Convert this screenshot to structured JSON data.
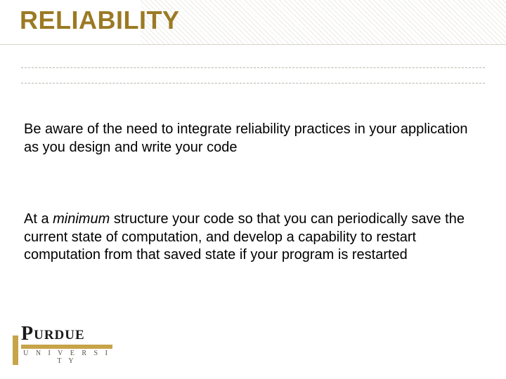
{
  "title": "RELIABILITY",
  "paragraph1": "Be aware of the need to integrate reliability practices in your application as you design and write your code",
  "paragraph2_pre": "At a ",
  "paragraph2_em": "minimum",
  "paragraph2_post": " structure your code so that you can periodically save the current state of computation, and develop a capability to restart computation from that saved state if your program is restarted",
  "logo": {
    "p": "P",
    "urdue": "URDUE",
    "university": "U N I V E R S I T Y"
  }
}
